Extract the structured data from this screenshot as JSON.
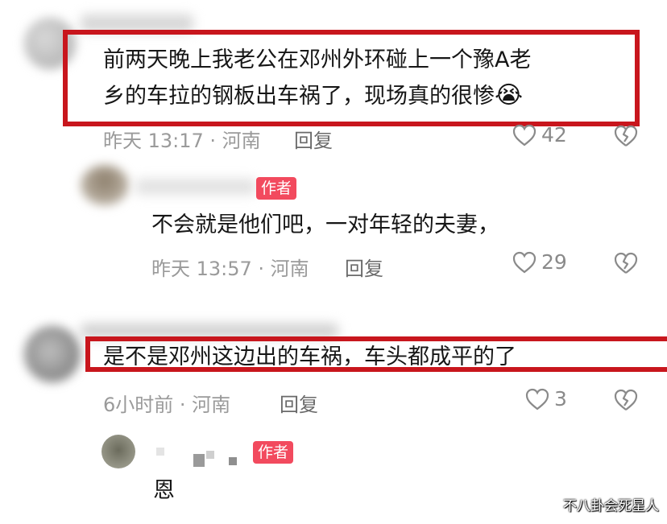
{
  "comments": [
    {
      "text_line1": "前两天晚上我老公在邓州外环碰上一个豫A老",
      "text_line2": "乡的车拉的钢板出车祸了，现场真的很惨",
      "emoji": "😭",
      "meta": "昨天 13:17 · 河南",
      "reply": "回复",
      "likes": "42"
    },
    {
      "badge": "作者",
      "text": "不会就是他们吧，一对年轻的夫妻，",
      "meta": "昨天 13:57 · 河南",
      "reply": "回复",
      "likes": "29"
    },
    {
      "text": "是不是邓州这边出的车祸，车头都成平的了",
      "meta": "6小时前 · 河南",
      "reply": "回复",
      "likes": "3"
    },
    {
      "badge": "作者",
      "text": "恩"
    }
  ],
  "watermark": "不八卦会死星人",
  "colors": {
    "highlight_border": "#c8161d",
    "author_badge": "#f24a5e",
    "meta_text": "#9a9a9a"
  },
  "icons": [
    "heart-icon",
    "broken-heart-icon",
    "crying-emoji"
  ]
}
